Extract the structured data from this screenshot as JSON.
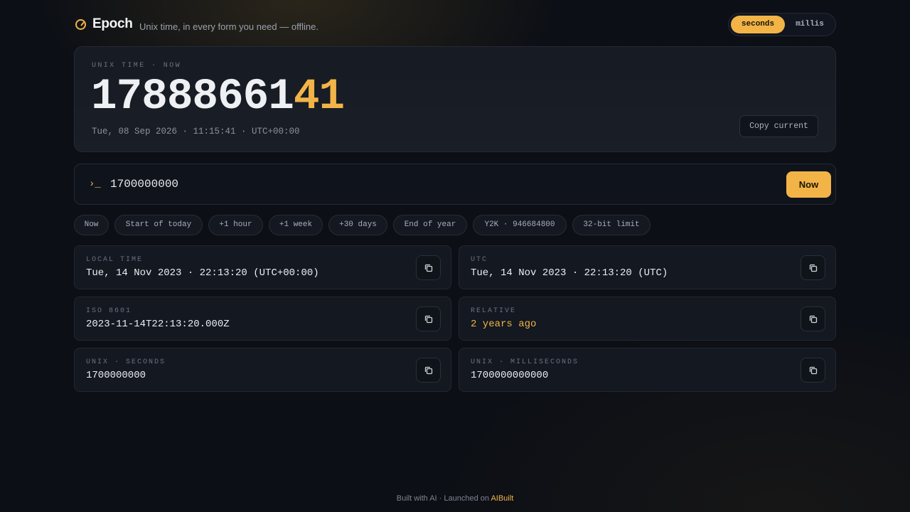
{
  "brand": {
    "name": "Epoch",
    "tagline": "Unix time, in every form you need — offline."
  },
  "unit_toggle": {
    "options": [
      "seconds",
      "millis"
    ],
    "selected": "seconds"
  },
  "hero": {
    "label": "UNIX TIME · NOW",
    "number_main": "17888661",
    "number_accent": "41",
    "date": "Tue, 08 Sep 2026 · 11:15:41 · UTC+00:00",
    "copy_label": "Copy current"
  },
  "input": {
    "prompt": "›_",
    "value": "1700000000",
    "now_label": "Now"
  },
  "presets": [
    "Now",
    "Start of today",
    "+1 hour",
    "+1 week",
    "+30 days",
    "End of year",
    "Y2K · 946684800",
    "32-bit limit"
  ],
  "cards": [
    {
      "label": "LOCAL TIME",
      "value": "Tue, 14 Nov 2023 · 22:13:20 (UTC+00:00)"
    },
    {
      "label": "UTC",
      "value": "Tue, 14 Nov 2023 · 22:13:20 (UTC)"
    },
    {
      "label": "ISO 8601",
      "value": "2023-11-14T22:13:20.000Z"
    },
    {
      "label": "RELATIVE",
      "value": "2 years ago"
    },
    {
      "label": "UNIX · SECONDS",
      "value": "1700000000"
    },
    {
      "label": "UNIX · MILLISECONDS",
      "value": "1700000000000"
    }
  ],
  "footer": {
    "text": "Built with AI · Launched on",
    "link": "AIBuilt"
  },
  "colors": {
    "accent": "#f2b447",
    "background": "#0c0f15",
    "card": "#131821"
  },
  "icons": {
    "brand": "clock-icon",
    "copy": "copy-icon"
  }
}
